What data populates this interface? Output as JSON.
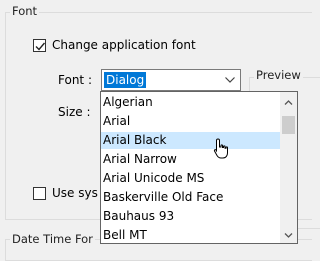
{
  "font_group": {
    "title": "Font"
  },
  "change_font_checkbox": {
    "label": "Change application font",
    "checked": true
  },
  "font_field": {
    "label": "Font :",
    "value": "Dialog"
  },
  "size_field": {
    "label": "Size :"
  },
  "preview_group": {
    "title": "Preview"
  },
  "use_system_checkbox": {
    "label": "Use sys",
    "checked": false
  },
  "date_time_group": {
    "title": "Date Time For"
  },
  "font_list": {
    "items": [
      "Algerian",
      "Arial",
      "Arial Black",
      "Arial Narrow",
      "Arial Unicode MS",
      "Baskerville Old Face",
      "Bauhaus 93",
      "Bell MT"
    ],
    "highlighted": "Arial Black"
  },
  "icons": {
    "dropdown": "chevron-down-icon",
    "scroll_up": "scroll-up-icon",
    "scroll_down": "scroll-down-icon",
    "cursor": "hand-pointer-icon"
  },
  "colors": {
    "selection": "#0078d7",
    "hover": "#cce8ff"
  }
}
